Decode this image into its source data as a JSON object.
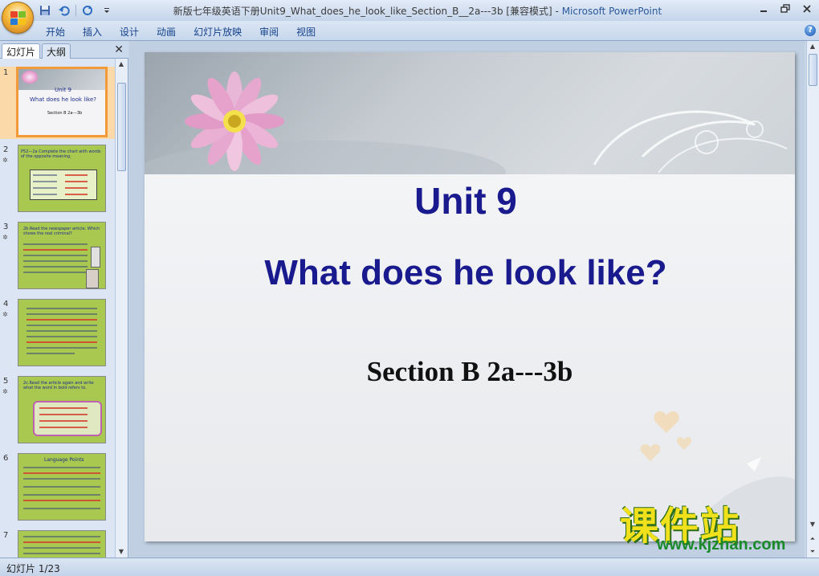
{
  "window": {
    "title": "新版七年级英语下册Unit9_What_does_he_look_like_Section_B__2a---3b [兼容模式] - ",
    "app_name": "Microsoft PowerPoint"
  },
  "quick_access": {
    "icons": [
      "save-icon",
      "undo-icon",
      "redo-icon",
      "customize-icon"
    ]
  },
  "ribbon": {
    "tabs": [
      "开始",
      "插入",
      "设计",
      "动画",
      "幻灯片放映",
      "审阅",
      "视图"
    ]
  },
  "left_pane": {
    "tab_slides": "幻灯片",
    "tab_outline": "大纲",
    "close": "✕",
    "thumbnails": [
      {
        "num": "1",
        "title": "Unit 9",
        "subtitle": "What does he look like?",
        "section": "Section B 2a---3b"
      },
      {
        "num": "2",
        "title": "P52—2a Complete the chart with words of the opposite meaning."
      },
      {
        "num": "3",
        "title": "2b.Read the newspaper article. Which shows the real criminal?"
      },
      {
        "num": "4"
      },
      {
        "num": "5",
        "title": "2c.Read the article again and write what the word in bold refers to."
      },
      {
        "num": "6",
        "title": "Language Points"
      },
      {
        "num": "7"
      }
    ]
  },
  "slide": {
    "title": "Unit 9",
    "subtitle": "What does he look like?",
    "section": "Section B 2a---3b"
  },
  "watermark": {
    "cn": "课件站",
    "url": "www.kjzhan.com"
  },
  "status": {
    "slide_counter": "幻灯片 1/23"
  },
  "colors": {
    "title_blue": "#1a1a8f",
    "thumb_green": "#a8c850",
    "selection_orange": "#f29a3a"
  }
}
